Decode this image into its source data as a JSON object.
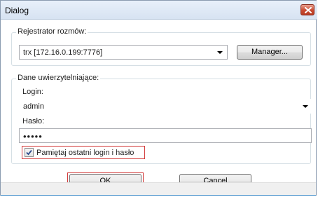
{
  "window": {
    "title": "Dialog"
  },
  "recorder": {
    "legend": "Rejestrator rozmów:",
    "selected": "trx  [172.16.0.199:7776]",
    "manager_label": "Manager..."
  },
  "credentials": {
    "legend": "Dane uwierzytelniające:",
    "login_label": "Login:",
    "login_value": "admin",
    "password_label": "Hasło:",
    "password_value": "•••••",
    "remember_label": "Pamiętaj ostatni login i hasło",
    "remember_checked": true
  },
  "buttons": {
    "ok": "OK",
    "cancel": "Cancel"
  },
  "colors": {
    "highlight": "#d23a3a",
    "close_button": "#c94a31"
  }
}
